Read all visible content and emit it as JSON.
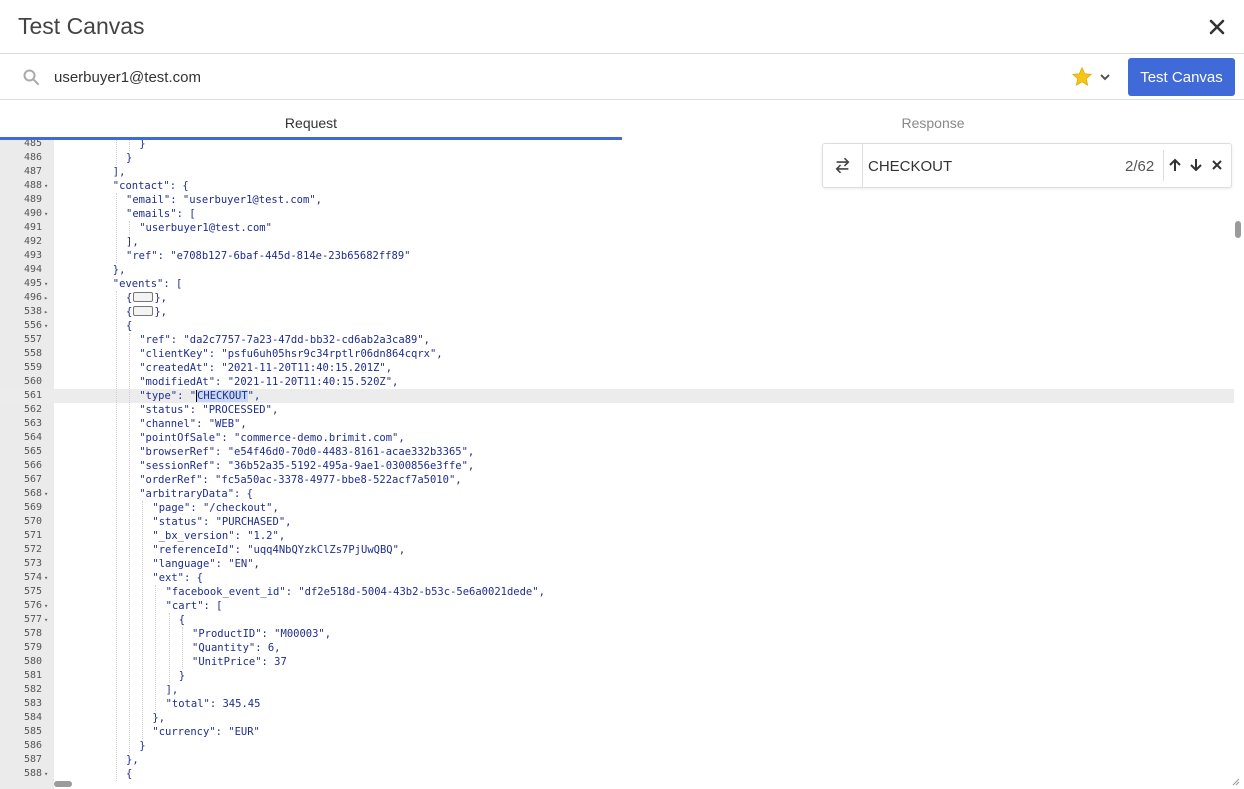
{
  "window": {
    "title": "Test Canvas"
  },
  "search": {
    "value": "userbuyer1@test.com"
  },
  "toolbar": {
    "run_label": "Test Canvas",
    "star_color": "#f5c518"
  },
  "tabs": [
    {
      "label": "Request",
      "active": true
    },
    {
      "label": "Response",
      "active": false
    }
  ],
  "find": {
    "query": "CHECKOUT",
    "count": "2/62"
  },
  "editor": {
    "lines": [
      {
        "n": "485",
        "indent": 6,
        "text": "}"
      },
      {
        "n": "486",
        "indent": 5,
        "text": "}"
      },
      {
        "n": "487",
        "indent": 4,
        "text": "],"
      },
      {
        "n": "488",
        "indent": 4,
        "text": "\"contact\": {",
        "fold": "open"
      },
      {
        "n": "489",
        "indent": 5,
        "text": "\"email\": \"userbuyer1@test.com\","
      },
      {
        "n": "490",
        "indent": 5,
        "text": "\"emails\": [",
        "fold": "open"
      },
      {
        "n": "491",
        "indent": 6,
        "text": "\"userbuyer1@test.com\""
      },
      {
        "n": "492",
        "indent": 5,
        "text": "],"
      },
      {
        "n": "493",
        "indent": 5,
        "text": "\"ref\": \"e708b127-6baf-445d-814e-23b65682ff89\""
      },
      {
        "n": "494",
        "indent": 4,
        "text": "},"
      },
      {
        "n": "495",
        "indent": 4,
        "text": "\"events\": [",
        "fold": "open"
      },
      {
        "n": "496",
        "indent": 5,
        "text": "{",
        "after": "},",
        "collapsed": true,
        "fold": "closed"
      },
      {
        "n": "538",
        "indent": 5,
        "text": "{",
        "after": "},",
        "collapsed": true,
        "fold": "closed"
      },
      {
        "n": "556",
        "indent": 5,
        "text": "{",
        "fold": "open"
      },
      {
        "n": "557",
        "indent": 6,
        "text": "\"ref\": \"da2c7757-7a23-47dd-bb32-cd6ab2a3ca89\","
      },
      {
        "n": "558",
        "indent": 6,
        "text": "\"clientKey\": \"psfu6uh05hsr9c34rptlr06dn864cqrx\","
      },
      {
        "n": "559",
        "indent": 6,
        "text": "\"createdAt\": \"2021-11-20T11:40:15.201Z\","
      },
      {
        "n": "560",
        "indent": 6,
        "text": "\"modifiedAt\": \"2021-11-20T11:40:15.520Z\","
      },
      {
        "n": "561",
        "indent": 6,
        "text": "\"type\": \"",
        "match": "CHECKOUT",
        "after": "\",",
        "current": true
      },
      {
        "n": "562",
        "indent": 6,
        "text": "\"status\": \"PROCESSED\","
      },
      {
        "n": "563",
        "indent": 6,
        "text": "\"channel\": \"WEB\","
      },
      {
        "n": "564",
        "indent": 6,
        "text": "\"pointOfSale\": \"commerce-demo.brimit.com\","
      },
      {
        "n": "565",
        "indent": 6,
        "text": "\"browserRef\": \"e54f46d0-70d0-4483-8161-acae332b3365\","
      },
      {
        "n": "566",
        "indent": 6,
        "text": "\"sessionRef\": \"36b52a35-5192-495a-9ae1-0300856e3ffe\","
      },
      {
        "n": "567",
        "indent": 6,
        "text": "\"orderRef\": \"fc5a50ac-3378-4977-bbe8-522acf7a5010\","
      },
      {
        "n": "568",
        "indent": 6,
        "text": "\"arbitraryData\": {",
        "fold": "open"
      },
      {
        "n": "569",
        "indent": 7,
        "text": "\"page\": \"/checkout\","
      },
      {
        "n": "570",
        "indent": 7,
        "text": "\"status\": \"PURCHASED\","
      },
      {
        "n": "571",
        "indent": 7,
        "text": "\"_bx_version\": \"1.2\","
      },
      {
        "n": "572",
        "indent": 7,
        "text": "\"referenceId\": \"uqq4NbQYzkClZs7PjUwQBQ\","
      },
      {
        "n": "573",
        "indent": 7,
        "text": "\"language\": \"EN\","
      },
      {
        "n": "574",
        "indent": 7,
        "text": "\"ext\": {",
        "fold": "open"
      },
      {
        "n": "575",
        "indent": 8,
        "text": "\"facebook_event_id\": \"df2e518d-5004-43b2-b53c-5e6a0021dede\","
      },
      {
        "n": "576",
        "indent": 8,
        "text": "\"cart\": [",
        "fold": "open"
      },
      {
        "n": "577",
        "indent": 9,
        "text": "{",
        "fold": "open"
      },
      {
        "n": "578",
        "indent": 10,
        "text": "\"ProductID\": \"M00003\","
      },
      {
        "n": "579",
        "indent": 10,
        "text": "\"Quantity\": 6,"
      },
      {
        "n": "580",
        "indent": 10,
        "text": "\"UnitPrice\": 37"
      },
      {
        "n": "581",
        "indent": 9,
        "text": "}"
      },
      {
        "n": "582",
        "indent": 8,
        "text": "],"
      },
      {
        "n": "583",
        "indent": 8,
        "text": "\"total\": 345.45"
      },
      {
        "n": "584",
        "indent": 7,
        "text": "},"
      },
      {
        "n": "585",
        "indent": 7,
        "text": "\"currency\": \"EUR\""
      },
      {
        "n": "586",
        "indent": 6,
        "text": "}"
      },
      {
        "n": "587",
        "indent": 5,
        "text": "},"
      },
      {
        "n": "588",
        "indent": 5,
        "text": "{",
        "fold": "open"
      }
    ]
  }
}
